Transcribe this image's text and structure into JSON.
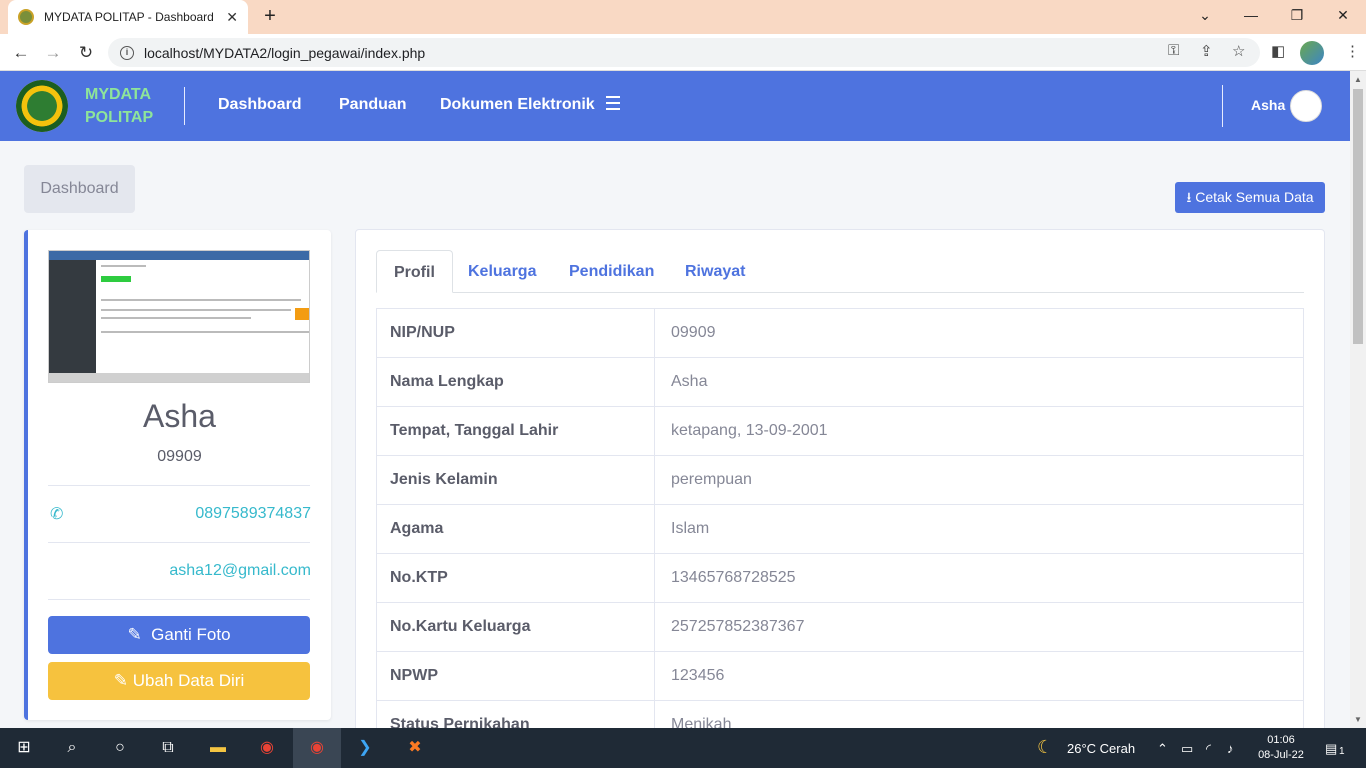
{
  "browser": {
    "tab_title": "MYDATA POLITAP - Dashboard",
    "url": "localhost/MYDATA2/login_pegawai/index.php"
  },
  "navbar": {
    "brand_line1": "MYDATA",
    "brand_line2": "POLITAP",
    "links": [
      "Dashboard",
      "Panduan",
      "Dokumen Elektronik"
    ],
    "user": "Asha"
  },
  "breadcrumb": "Dashboard",
  "print_button": "Cetak Semua Data",
  "profile": {
    "name": "Asha",
    "nip": "09909",
    "phone": "0897589374837",
    "email": "asha12@gmail.com",
    "change_photo": "Ganti Foto",
    "edit_data": "Ubah Data Diri"
  },
  "tabs": [
    "Profil",
    "Keluarga",
    "Pendidikan",
    "Riwayat"
  ],
  "details": [
    {
      "label": "NIP/NUP",
      "value": "09909"
    },
    {
      "label": "Nama Lengkap",
      "value": "Asha"
    },
    {
      "label": "Tempat, Tanggal Lahir",
      "value": "ketapang, 13-09-2001"
    },
    {
      "label": "Jenis Kelamin",
      "value": "perempuan"
    },
    {
      "label": "Agama",
      "value": "Islam"
    },
    {
      "label": "No.KTP",
      "value": "13465768728525"
    },
    {
      "label": "No.Kartu Keluarga",
      "value": "257257852387367"
    },
    {
      "label": "NPWP",
      "value": "123456"
    },
    {
      "label": "Status Pernikahan",
      "value": "Menikah"
    }
  ],
  "taskbar": {
    "weather": "26°C  Cerah",
    "time": "01:06",
    "date": "08-Jul-22",
    "notifications": "1"
  },
  "colors": {
    "primary": "#4e73df",
    "warning": "#f6c23e",
    "info": "#36b9cc",
    "brand_text": "#8ee59a"
  }
}
